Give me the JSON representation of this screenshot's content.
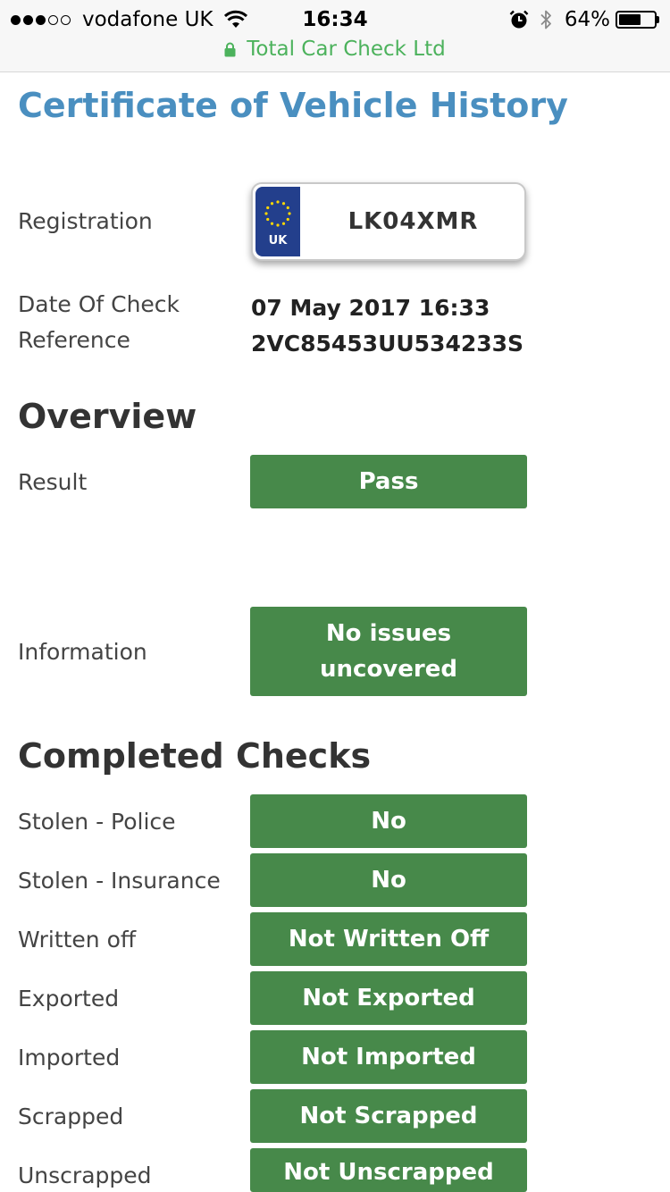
{
  "status_bar": {
    "carrier": "vodafone UK",
    "time": "16:34",
    "battery_percent": "64%",
    "battery_level": 0.64,
    "signal_bars_filled": 3,
    "signal_bars_total": 5
  },
  "browser": {
    "site_name": "Total Car Check Ltd",
    "accent_color": "#4cb25c"
  },
  "page": {
    "title": "Certificate of Vehicle History",
    "title_color": "#4a8fc0"
  },
  "details": {
    "registration_label": "Registration",
    "plate_country": "UK",
    "plate_number": "LK04XMR",
    "date_label": "Date Of Check",
    "date_value": "07 May 2017 16:33",
    "reference_label": "Reference",
    "reference_value": "2VC85453UU534233S"
  },
  "overview": {
    "heading": "Overview",
    "result_label": "Result",
    "result_value": "Pass",
    "information_label": "Information",
    "information_value": "No issues uncovered"
  },
  "checks": {
    "heading": "Completed Checks",
    "badge_color": "#47894a",
    "items": [
      {
        "label": "Stolen - Police",
        "value": "No"
      },
      {
        "label": "Stolen - Insurance",
        "value": "No"
      },
      {
        "label": "Written off",
        "value": "Not Written Off"
      },
      {
        "label": "Exported",
        "value": "Not Exported"
      },
      {
        "label": "Imported",
        "value": "Not Imported"
      },
      {
        "label": "Scrapped",
        "value": "Not Scrapped"
      },
      {
        "label": "Unscrapped",
        "value": "Not Unscrapped"
      }
    ]
  }
}
